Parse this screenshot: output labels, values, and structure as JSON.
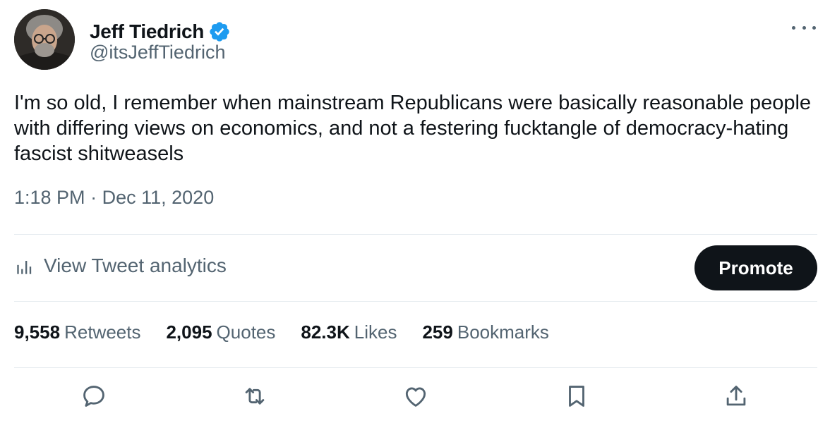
{
  "author": {
    "name": "Jeff Tiedrich",
    "handle": "@itsJeffTiedrich",
    "verified": true
  },
  "tweet": {
    "text": "I'm so old, I remember when mainstream Republicans were basically reasonable people with differing views on economics, and not a festering fucktangle of democracy-hating fascist shitweasels",
    "time": "1:18 PM",
    "separator": "·",
    "date": "Dec 11, 2020"
  },
  "analytics": {
    "label": "View Tweet analytics",
    "promote_label": "Promote"
  },
  "stats": [
    {
      "value": "9,558",
      "label": "Retweets"
    },
    {
      "value": "2,095",
      "label": "Quotes"
    },
    {
      "value": "82.3K",
      "label": "Likes"
    },
    {
      "value": "259",
      "label": "Bookmarks"
    }
  ],
  "icons": {
    "verified": "verified-badge-icon",
    "more": "more-options-icon",
    "analytics": "bar-chart-icon",
    "actions": [
      "reply-icon",
      "retweet-icon",
      "like-icon",
      "bookmark-icon",
      "share-icon"
    ]
  },
  "colors": {
    "text_primary": "#0f1419",
    "text_secondary": "#536471",
    "verified_blue": "#1d9bf0",
    "promote_bg": "#0f1419",
    "divider": "#e6ecf0"
  }
}
